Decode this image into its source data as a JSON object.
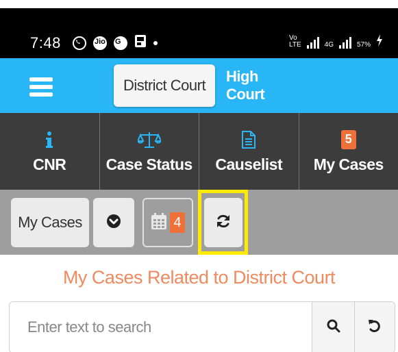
{
  "status_bar": {
    "time": "7:48",
    "left_icons": [
      "whatsapp-icon",
      "jio-icon",
      "google-icon",
      "gallery-icon",
      "notification-dot-icon"
    ],
    "network_volte": "Vo\nLTE",
    "network_4g": "4G",
    "battery": "57%"
  },
  "court_tabs": {
    "active": "District Court",
    "inactive": "High Court"
  },
  "nav": {
    "items": [
      {
        "label": "CNR",
        "icon": "info-icon"
      },
      {
        "label": "Case Status",
        "icon": "scales-icon"
      },
      {
        "label": "Causelist",
        "icon": "document-icon"
      },
      {
        "label": "My Cases",
        "icon": "count-badge",
        "badge": "5"
      }
    ]
  },
  "toolbar": {
    "my_cases_label": "My Cases",
    "dropdown_icon": "chevron-circle-down-icon",
    "calendar_icon": "calendar-icon",
    "calendar_count": "4",
    "refresh_icon": "refresh-icon",
    "highlight_color": "#FFEB00"
  },
  "main": {
    "title": "My Cases Related to District Court"
  },
  "search": {
    "placeholder": "Enter text to search",
    "value": "",
    "search_icon": "search-icon",
    "reset_icon": "undo-icon"
  },
  "colors": {
    "accent_blue": "#29B6F6",
    "nav_dark": "#3c3c3c",
    "toolbar_gray": "#9e9e9e",
    "badge_orange": "#F0703A",
    "title_orange": "#EE8A5E"
  }
}
